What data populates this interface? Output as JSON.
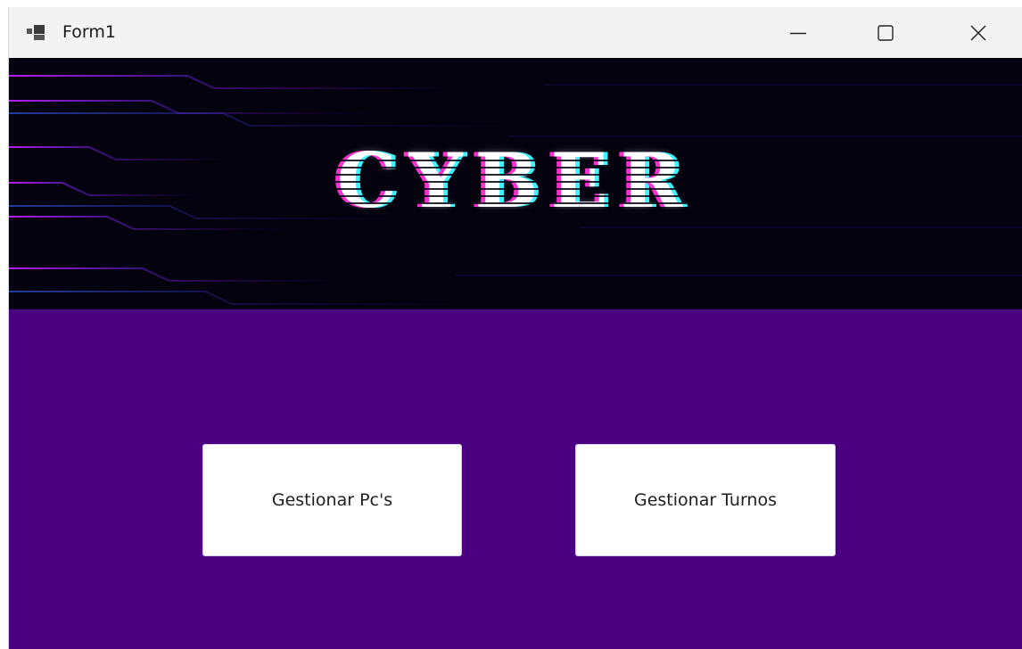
{
  "window": {
    "title": "Form1",
    "icon": "app-window-icon",
    "controls": [
      "minimize-icon",
      "maximize-icon",
      "close-icon"
    ]
  },
  "banner": {
    "text": "CYBER",
    "colors": {
      "background": "#04020f",
      "glitch_magenta": "#ff2fd0",
      "glitch_cyan": "#3ff3ff",
      "circuit_lines": "#b01fff"
    }
  },
  "main": {
    "background": "#4b0082",
    "buttons": {
      "pcs_label": "Gestionar Pc's",
      "turnos_label": "Gestionar Turnos"
    }
  }
}
